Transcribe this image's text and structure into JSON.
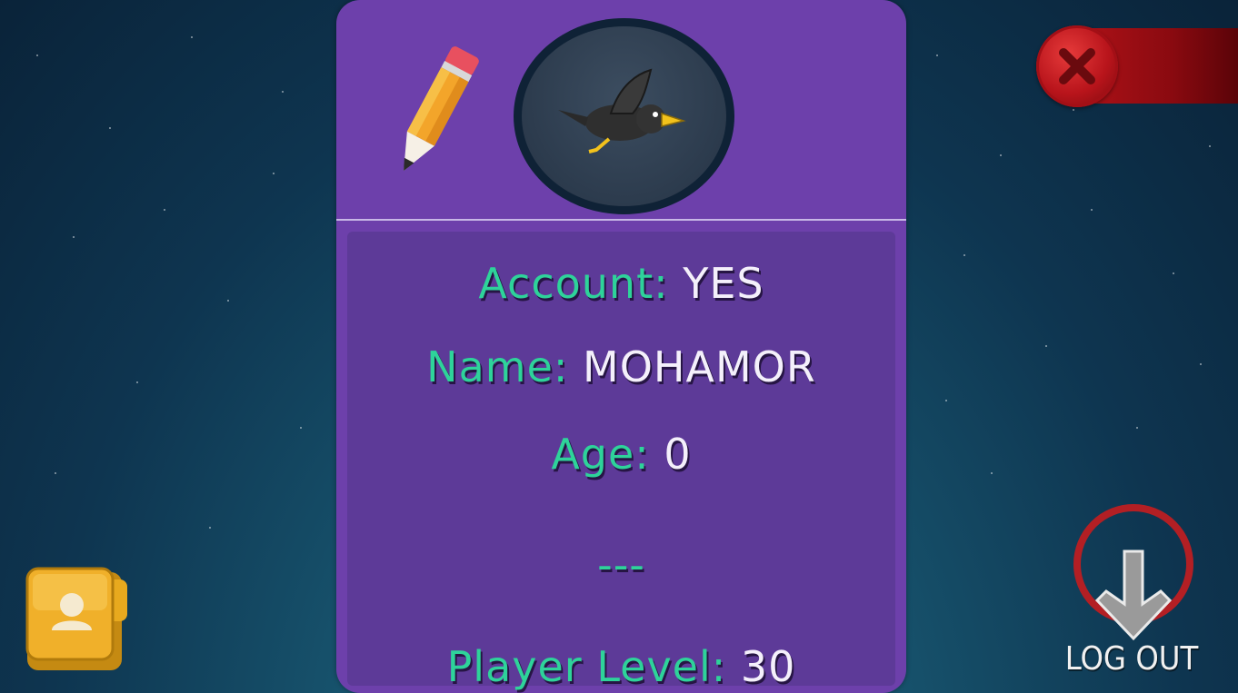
{
  "profile": {
    "account_label": "Account:",
    "account_value": "YES",
    "name_label": "Name:",
    "name_value": "MOHAMOR",
    "age_label": "Age:",
    "age_value": "0",
    "separator": "---",
    "level_label": "Player Level:",
    "level_value": "30",
    "avatar_icon": "crow-avatar-icon",
    "edit_icon": "pencil-icon"
  },
  "controls": {
    "close_icon": "close-x-icon",
    "profile_icon": "profile-folder-icon",
    "logout_icon": "logout-arrow-icon",
    "logout_label": "LOG OUT"
  },
  "colors": {
    "card_bg": "#6d40ab",
    "panel_bg": "#5d3a98",
    "label_green": "#2ed39a",
    "value_white": "#f4f0fb",
    "close_red": "#b8141b",
    "folder_gold": "#f0b02a"
  }
}
